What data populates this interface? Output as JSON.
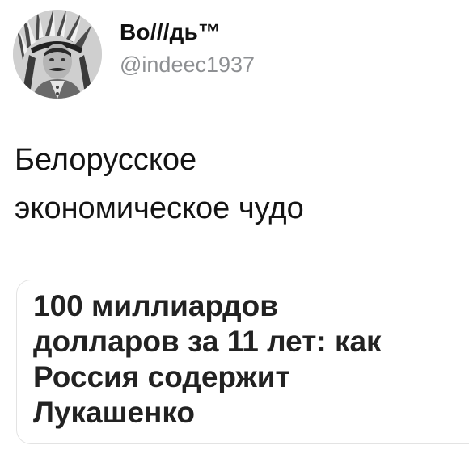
{
  "tweet": {
    "author": {
      "display_name": "Во///дь™",
      "handle": "@indeec1937",
      "avatar_icon": "profile-photo-avatar"
    },
    "text": "Белорусское\nэкономическое чудо",
    "card": {
      "title": "100 миллиардов\nдолларов за 11 лет: как\nРоссия содержит\nЛукашенко"
    }
  },
  "colors": {
    "background": "#ffffff",
    "text": "#141414",
    "handle": "#8e9093",
    "card_border": "#e3e3e3"
  }
}
